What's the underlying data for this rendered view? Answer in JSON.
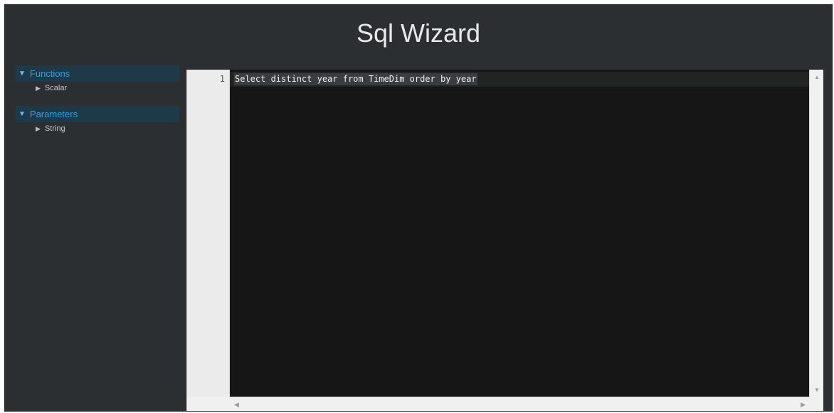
{
  "app": {
    "title": "Sql Wizard"
  },
  "sidebar": {
    "groups": [
      {
        "label": "Functions",
        "caret": "▼",
        "items": [
          {
            "label": "Scalar",
            "caret": "▶"
          }
        ]
      },
      {
        "label": "Parameters",
        "caret": "▼",
        "items": [
          {
            "label": "String",
            "caret": "▶"
          }
        ]
      }
    ]
  },
  "editor": {
    "lines": [
      {
        "number": "1",
        "text": "Select distinct year from TimeDim order by year"
      }
    ]
  },
  "scrollbars": {
    "up": "▲",
    "down": "▼",
    "left": "◀",
    "right": "▶"
  },
  "colors": {
    "background": "#2c2f31",
    "accent": "#2d9fe0",
    "editor_bg": "#161616"
  }
}
